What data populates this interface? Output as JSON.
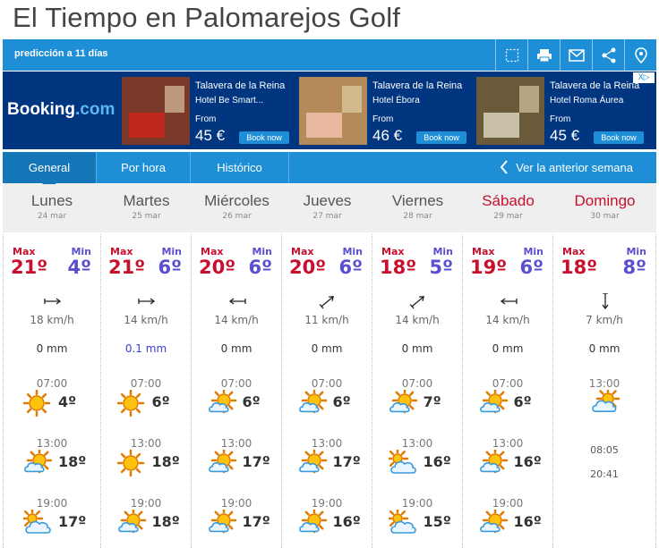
{
  "title": "El Tiempo en Palomarejos Golf",
  "subtitle": "predicción a 11 días",
  "toolbar_icons": [
    "fullscreen-icon",
    "print-icon",
    "mail-icon",
    "share-icon",
    "location-icon"
  ],
  "ad": {
    "brand_main": "Booking",
    "brand_tld": ".com",
    "close": "X▷",
    "hotels": [
      {
        "city": "Talavera de la Reina",
        "name": "Hotel Be Smart...",
        "from": "From",
        "price": "45 €",
        "cta": "Book now"
      },
      {
        "city": "Talavera de la Reina",
        "name": "Hotel Ébora",
        "from": "From",
        "price": "46 €",
        "cta": "Book now"
      },
      {
        "city": "Talavera de la Reina",
        "name": "Hotel Roma Áurea",
        "from": "From",
        "price": "45 €",
        "cta": "Book now"
      }
    ]
  },
  "tabs": [
    "General",
    "Por hora",
    "Histórico"
  ],
  "prev_week": "Ver la anterior semana",
  "labels": {
    "max": "Max",
    "min": "Min"
  },
  "days": [
    {
      "name": "Lunes",
      "date": "24 mar",
      "weekend": false,
      "max": "21º",
      "min": "4º",
      "wind": "18 km/h",
      "wind_dir": "E",
      "rain": "0 mm",
      "wet": false,
      "slots": [
        {
          "time": "07:00",
          "icon": "sun",
          "temp": "4º"
        },
        {
          "time": "13:00",
          "icon": "sun-cloud",
          "temp": "18º"
        },
        {
          "time": "19:00",
          "icon": "cloud",
          "temp": "17º"
        }
      ]
    },
    {
      "name": "Martes",
      "date": "25 mar",
      "weekend": false,
      "max": "21º",
      "min": "6º",
      "wind": "14 km/h",
      "wind_dir": "E",
      "rain": "0.1 mm",
      "wet": true,
      "slots": [
        {
          "time": "07:00",
          "icon": "sun",
          "temp": "6º"
        },
        {
          "time": "13:00",
          "icon": "sun",
          "temp": "18º"
        },
        {
          "time": "19:00",
          "icon": "sun-cloud",
          "temp": "18º"
        }
      ]
    },
    {
      "name": "Miércoles",
      "date": "26 mar",
      "weekend": false,
      "max": "20º",
      "min": "6º",
      "wind": "14 km/h",
      "wind_dir": "W",
      "rain": "0 mm",
      "wet": false,
      "slots": [
        {
          "time": "07:00",
          "icon": "sun-cloud",
          "temp": "6º"
        },
        {
          "time": "13:00",
          "icon": "sun-cloud",
          "temp": "17º"
        },
        {
          "time": "19:00",
          "icon": "sun-cloud",
          "temp": "17º"
        }
      ]
    },
    {
      "name": "Jueves",
      "date": "27 mar",
      "weekend": false,
      "max": "20º",
      "min": "6º",
      "wind": "11 km/h",
      "wind_dir": "NE",
      "rain": "0 mm",
      "wet": false,
      "slots": [
        {
          "time": "07:00",
          "icon": "sun-cloud",
          "temp": "6º"
        },
        {
          "time": "13:00",
          "icon": "sun-cloud",
          "temp": "17º"
        },
        {
          "time": "19:00",
          "icon": "sun-cloud",
          "temp": "16º"
        }
      ]
    },
    {
      "name": "Viernes",
      "date": "28 mar",
      "weekend": false,
      "max": "18º",
      "min": "5º",
      "wind": "14 km/h",
      "wind_dir": "NE",
      "rain": "0 mm",
      "wet": false,
      "slots": [
        {
          "time": "07:00",
          "icon": "sun-cloud",
          "temp": "7º"
        },
        {
          "time": "13:00",
          "icon": "cloud",
          "temp": "16º"
        },
        {
          "time": "19:00",
          "icon": "cloud",
          "temp": "15º"
        }
      ]
    },
    {
      "name": "Sábado",
      "date": "29 mar",
      "weekend": true,
      "max": "19º",
      "min": "6º",
      "wind": "14 km/h",
      "wind_dir": "W",
      "rain": "0 mm",
      "wet": false,
      "slots": [
        {
          "time": "07:00",
          "icon": "sun-cloud",
          "temp": "6º"
        },
        {
          "time": "13:00",
          "icon": "sun-cloud",
          "temp": "16º"
        },
        {
          "time": "19:00",
          "icon": "sun-cloud",
          "temp": "16º"
        }
      ]
    },
    {
      "name": "Domingo",
      "date": "30 mar",
      "weekend": true,
      "max": "18º",
      "min": "8º",
      "wind": "7 km/h",
      "wind_dir": "S",
      "rain": "0 mm",
      "wet": false,
      "slots": [
        {
          "time": "13:00",
          "icon": "cloud-sun",
          "temp": ""
        }
      ],
      "sunrise": "08:05",
      "sunset": "20:41"
    }
  ]
}
